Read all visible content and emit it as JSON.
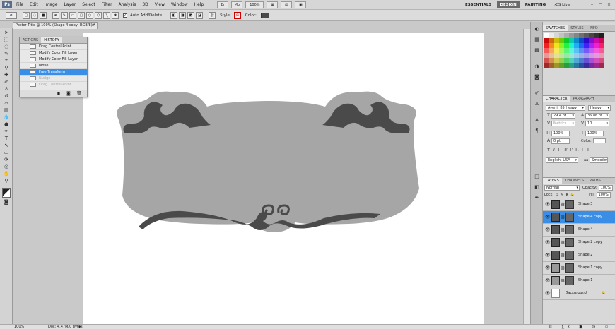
{
  "app": {
    "logo": "Ps"
  },
  "menubar": {
    "items": [
      "File",
      "Edit",
      "Image",
      "Layer",
      "Select",
      "Filter",
      "Analysis",
      "3D",
      "View",
      "Window",
      "Help"
    ],
    "zoom": "100%",
    "workspaces": [
      "ESSENTIALS",
      "DESIGN",
      "PAINTING"
    ],
    "active_workspace": "DESIGN",
    "more": "»",
    "cslive": "CS Live",
    "window_buttons": [
      "–",
      "□",
      "×"
    ]
  },
  "options_bar": {
    "auto_add_delete": "Auto Add/Delete",
    "auto_add_delete_checked": true,
    "style_label": "Style:",
    "color_label": "Color:",
    "color_value": "#4a4a4a"
  },
  "document_tab": {
    "title": "Poster Title @ 100% (Shape 4 copy, RGB/8) *",
    "close": "×"
  },
  "status_bar": {
    "zoom": "100%",
    "doc": "Doc: 4.47M/0 bytes"
  },
  "history_panel": {
    "tabs": [
      "ACTIONS",
      "HISTORY"
    ],
    "active_tab": "HISTORY",
    "items": [
      {
        "label": "Drag Control Point",
        "state": "normal"
      },
      {
        "label": "Modify Color Fill Layer",
        "state": "normal"
      },
      {
        "label": "Modify Color Fill Layer",
        "state": "normal"
      },
      {
        "label": "Move",
        "state": "normal"
      },
      {
        "label": "Free Transform",
        "state": "selected"
      },
      {
        "label": "Nudge",
        "state": "dim"
      },
      {
        "label": "Drag Control Point",
        "state": "dim"
      }
    ]
  },
  "swatches_panel": {
    "tabs": [
      "SWATCHES",
      "STYLES",
      "INFO"
    ],
    "active_tab": "SWATCHES"
  },
  "character_panel": {
    "tabs": [
      "CHARACTER",
      "PARAGRAPH"
    ],
    "active_tab": "CHARACTER",
    "font_family": "Avenir 85 Heavy",
    "font_style": "Heavy",
    "font_size": "29.4 pt",
    "leading": "36.86 pt",
    "kerning": "Metrics",
    "tracking": "10",
    "vscale": "100%",
    "hscale": "100%",
    "baseline": "0 pt",
    "color_label": "Color:",
    "faux_styles": [
      "T",
      "T",
      "TT",
      "Tr",
      "T'",
      "T,",
      "T",
      "T"
    ],
    "language": "English: USA",
    "aa_label": "aa",
    "antialias": "Smooth"
  },
  "layers_panel": {
    "tabs": [
      "LAYERS",
      "CHANNELS",
      "PATHS"
    ],
    "active_tab": "LAYERS",
    "blend_mode": "Normal",
    "opacity_label": "Opacity:",
    "opacity": "100%",
    "lock_label": "Lock:",
    "fill_label": "Fill:",
    "fill": "100%",
    "layers": [
      {
        "name": "Shape 3",
        "selected": false
      },
      {
        "name": "Shape 4 copy",
        "selected": true
      },
      {
        "name": "Shape 4",
        "selected": false
      },
      {
        "name": "Shape 2 copy",
        "selected": false
      },
      {
        "name": "Shape 2",
        "selected": false
      },
      {
        "name": "Shape 1 copy",
        "selected": false
      },
      {
        "name": "Shape 1",
        "selected": false
      },
      {
        "name": "Background",
        "selected": false
      }
    ]
  },
  "colors": {
    "banner_outer": "#a6a6a6",
    "banner_inner": "#4a4a4a",
    "selection_blue": "#3a8ee6"
  }
}
